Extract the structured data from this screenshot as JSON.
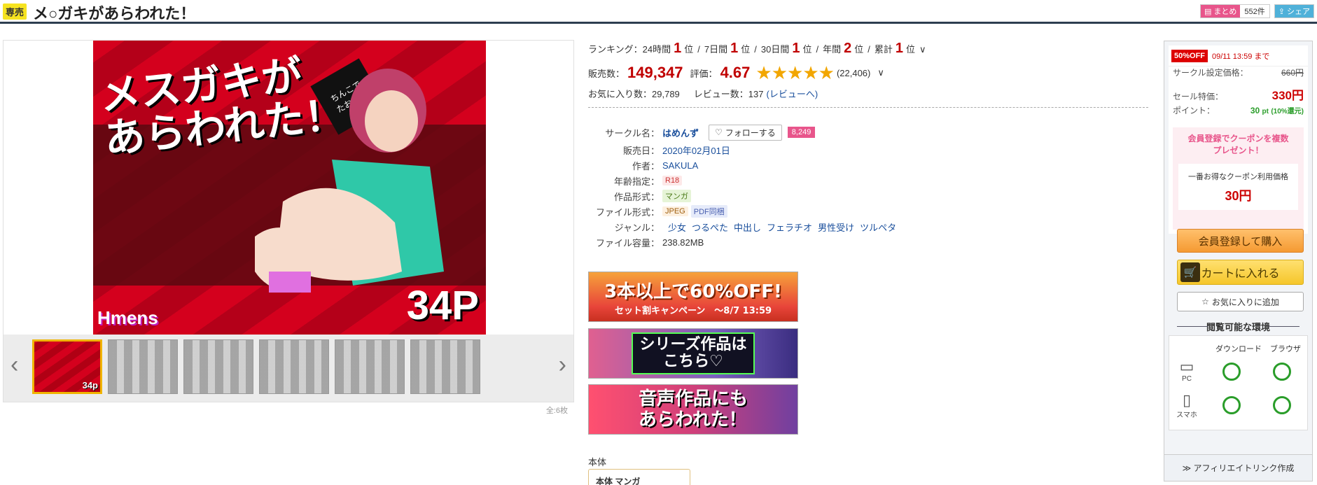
{
  "header": {
    "badge": "専売",
    "title": "メ○ガキがあらわれた！",
    "matome_label": "まとめ",
    "matome_count": "552件",
    "share_label": "シェア"
  },
  "gallery": {
    "cover_title_line1": "メスガキが",
    "cover_title_line2": "あらわれた！",
    "cover_hint": "ちんこで\nたおせ！",
    "cover_pages": "34P",
    "cover_logo": "Hmens",
    "thumb_page_label": "34p",
    "total_label": "全:6枚",
    "prev": "‹",
    "next": "›"
  },
  "ranking": {
    "label": "ランキング：",
    "items": [
      {
        "period": "24時間",
        "rank": "1",
        "unit": "位"
      },
      {
        "period": "7日間",
        "rank": "1",
        "unit": "位"
      },
      {
        "period": "30日間",
        "rank": "1",
        "unit": "位"
      },
      {
        "period": "年間",
        "rank": "2",
        "unit": "位"
      },
      {
        "period": "累計",
        "rank": "1",
        "unit": "位"
      }
    ],
    "sep": "/",
    "chevron": "∨"
  },
  "sales": {
    "label": "販売数：",
    "value": "149,347",
    "rating_label": "評価：",
    "rating": "4.67",
    "stars": "★★★★★",
    "rating_count": "(22,406)",
    "chevron": "∨",
    "rating_fraction": 0.934
  },
  "stats": {
    "fav_label": "お気に入り数：",
    "fav_value": "29,789",
    "review_label": "レビュー数：",
    "review_value": "137",
    "review_link": "(レビューへ)"
  },
  "spec": {
    "circle_label": "サークル名：",
    "circle_name": "はめんず",
    "follow_label": "フォローする",
    "follow_count": "8,249",
    "date_label": "販売日：",
    "date": "2020年02月01日",
    "author_label": "作者：",
    "author": "SAKULA",
    "age_label": "年齢指定：",
    "age": "R18",
    "form_label": "作品形式：",
    "form": "マンガ",
    "file_label": "ファイル形式：",
    "file_jpeg": "JPEG",
    "file_pdf": "PDF同梱",
    "genre_label": "ジャンル：",
    "genres": [
      "少女",
      "つるぺた",
      "中出し",
      "フェラチオ",
      "男性受け",
      "ツルペタ"
    ],
    "size_label": "ファイル容量：",
    "size": "238.82MB"
  },
  "banners": {
    "b1_main": "3本以上で60%OFF!",
    "b1_sub": "セット割キャンペーン　〜8/7 13:59",
    "b2": "シリーズ作品は\nこちら♡",
    "b3": "音声作品にも\nあらわれた！"
  },
  "honbun": {
    "label": "本体",
    "tab": "本体 マンガ"
  },
  "panel": {
    "off_badge": "50%OFF",
    "sale_until": "09/11 13:59 まで",
    "list_price_label": "サークル設定価格：",
    "list_price": "660円",
    "sale_label": "セール特価：",
    "sale_price": "330円",
    "point_label": "ポイント：",
    "points": "30",
    "points_unit": "pt",
    "points_rate": "(10%還元)",
    "coupon_title": "会員登録でクーポンを複数\nプレゼント！",
    "coupon_sub": "一番お得なクーポン利用価格",
    "coupon_price": "30円",
    "register_btn": "会員登録して購入",
    "cart_btn": "カートに入れる",
    "fav_btn": "お気に入りに追加",
    "env_title": "閲覧可能な環境",
    "env_download": "ダウンロード",
    "env_browser": "ブラウザ",
    "env_pc": "PC",
    "env_sp": "スマホ",
    "affiliate": "≫ アフィリエイトリンク作成"
  }
}
